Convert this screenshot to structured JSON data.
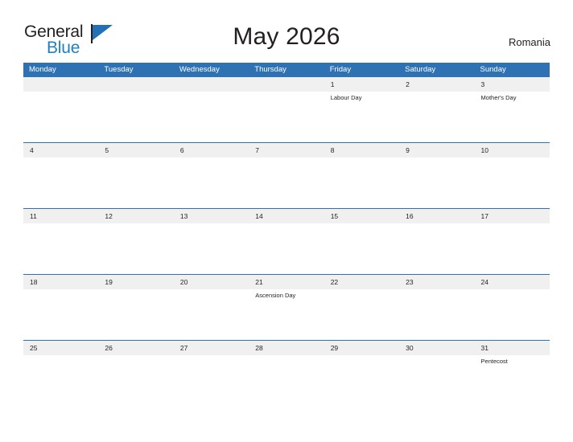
{
  "brand": {
    "name_top": "General",
    "name_bottom": "Blue",
    "flag_color": "#2170b8",
    "text_color": "#231f20",
    "blue_text_color": "#1f7fc4"
  },
  "header": {
    "title": "May 2026",
    "country": "Romania"
  },
  "theme": {
    "header_blue": "#2f72b4",
    "day_band_gray": "#f0f0f0",
    "cell_white": "#ffffff",
    "text_dark": "#231f20",
    "header_text": "#ffffff"
  },
  "calendar": {
    "weekday_headers": [
      "Monday",
      "Tuesday",
      "Wednesday",
      "Thursday",
      "Friday",
      "Saturday",
      "Sunday"
    ],
    "weeks": [
      [
        {
          "day": "",
          "events": []
        },
        {
          "day": "",
          "events": []
        },
        {
          "day": "",
          "events": []
        },
        {
          "day": "",
          "events": []
        },
        {
          "day": "1",
          "events": [
            "Labour Day"
          ]
        },
        {
          "day": "2",
          "events": []
        },
        {
          "day": "3",
          "events": [
            "Mother's Day"
          ]
        }
      ],
      [
        {
          "day": "4",
          "events": []
        },
        {
          "day": "5",
          "events": []
        },
        {
          "day": "6",
          "events": []
        },
        {
          "day": "7",
          "events": []
        },
        {
          "day": "8",
          "events": []
        },
        {
          "day": "9",
          "events": []
        },
        {
          "day": "10",
          "events": []
        }
      ],
      [
        {
          "day": "11",
          "events": []
        },
        {
          "day": "12",
          "events": []
        },
        {
          "day": "13",
          "events": []
        },
        {
          "day": "14",
          "events": []
        },
        {
          "day": "15",
          "events": []
        },
        {
          "day": "16",
          "events": []
        },
        {
          "day": "17",
          "events": []
        }
      ],
      [
        {
          "day": "18",
          "events": []
        },
        {
          "day": "19",
          "events": []
        },
        {
          "day": "20",
          "events": []
        },
        {
          "day": "21",
          "events": [
            "Ascension Day"
          ]
        },
        {
          "day": "22",
          "events": []
        },
        {
          "day": "23",
          "events": []
        },
        {
          "day": "24",
          "events": []
        }
      ],
      [
        {
          "day": "25",
          "events": []
        },
        {
          "day": "26",
          "events": []
        },
        {
          "day": "27",
          "events": []
        },
        {
          "day": "28",
          "events": []
        },
        {
          "day": "29",
          "events": []
        },
        {
          "day": "30",
          "events": []
        },
        {
          "day": "31",
          "events": [
            "Pentecost"
          ]
        }
      ]
    ]
  }
}
